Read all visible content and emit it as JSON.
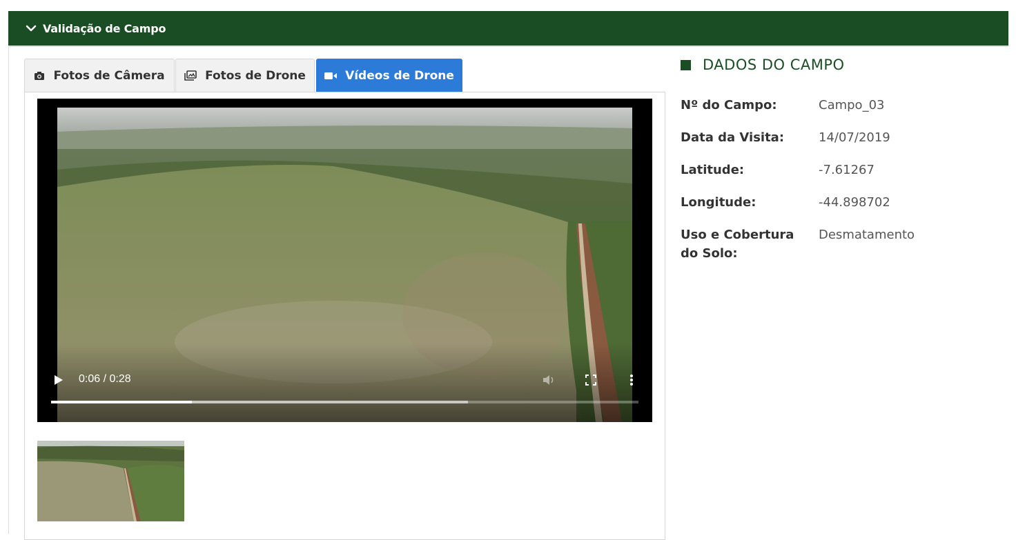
{
  "panel": {
    "title": "Validação de Campo"
  },
  "tabs": [
    {
      "label": "Fotos de Câmera",
      "icon": "camera-icon",
      "active": false
    },
    {
      "label": "Fotos de Drone",
      "icon": "images-icon",
      "active": false
    },
    {
      "label": "Vídeos de Drone",
      "icon": "video-camera-icon",
      "active": true
    }
  ],
  "video": {
    "time": "0:06 / 0:28",
    "played_fraction": 0.24,
    "buffered_fraction": 0.71
  },
  "details": {
    "title": "DADOS DO CAMPO",
    "fields": [
      {
        "label": "Nº do Campo:",
        "value": "Campo_03"
      },
      {
        "label": "Data da Visita:",
        "value": "14/07/2019"
      },
      {
        "label": "Latitude:",
        "value": "-7.61267"
      },
      {
        "label": "Longitude:",
        "value": "-44.898702"
      },
      {
        "label": "Uso e Cobertura do Solo:",
        "value": "Desmatamento"
      }
    ]
  },
  "colors": {
    "brand_green": "#1b4d24",
    "active_tab": "#2d7bd8"
  }
}
